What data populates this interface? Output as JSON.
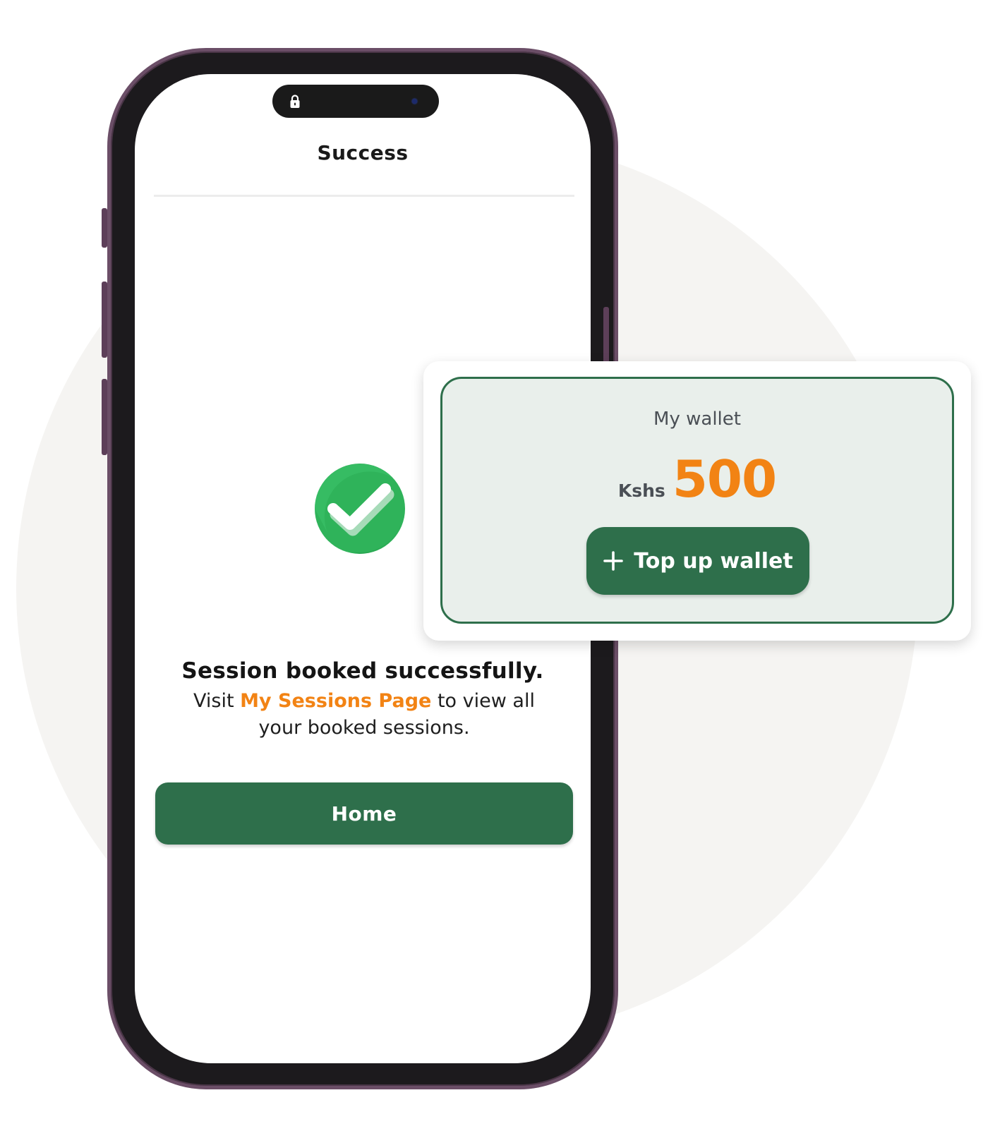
{
  "phone": {
    "screen_title": "Success",
    "message_title": "Session booked successfully.",
    "message_prefix": "Visit",
    "message_link": "My Sessions Page",
    "message_suffix": "to view all your booked sessions.",
    "home_button": "Home"
  },
  "wallet": {
    "label": "My wallet",
    "currency": "Kshs",
    "amount": "500",
    "topup_button": "Top up wallet"
  },
  "icons": {
    "lock": "lock-icon",
    "success": "check-circle-icon",
    "plus": "plus-icon"
  },
  "colors": {
    "primary_green": "#2e6f4b",
    "accent_orange": "#f28314",
    "check_green": "#2fb35a",
    "wallet_bg": "#e9efeb",
    "phone_frame": "#6b4e67"
  }
}
